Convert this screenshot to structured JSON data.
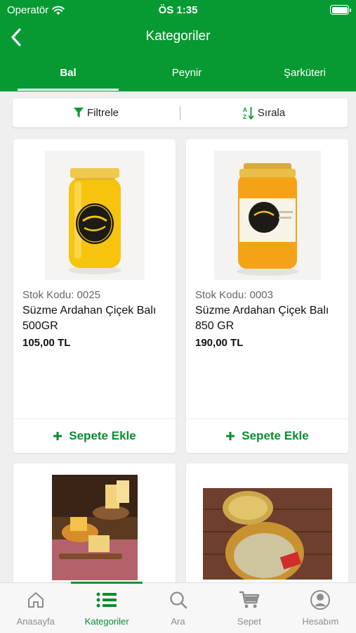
{
  "status": {
    "carrier": "Operatör",
    "time": "ÖS 1:35"
  },
  "header": {
    "title": "Kategoriler"
  },
  "tabs": [
    {
      "label": "Bal",
      "active": true
    },
    {
      "label": "Peynir",
      "active": false
    },
    {
      "label": "Şarküteri",
      "active": false
    }
  ],
  "toolbar": {
    "filter_label": "Filtrele",
    "sort_label": "Sırala"
  },
  "products": [
    {
      "sku": "Stok Kodu: 0025",
      "name": "Süzme Ardahan Çiçek Balı 500GR",
      "price": "105,00 TL",
      "cart_label": "Sepete Ekle"
    },
    {
      "sku": "Stok Kodu: 0003",
      "name": "Süzme Ardahan Çiçek Balı 850 GR",
      "price": "190,00 TL",
      "cart_label": "Sepete Ekle"
    }
  ],
  "bottom_nav": [
    {
      "label": "Anasayfa",
      "icon": "home-icon",
      "active": false
    },
    {
      "label": "Kategoriler",
      "icon": "list-icon",
      "active": true
    },
    {
      "label": "Ara",
      "icon": "search-icon",
      "active": false
    },
    {
      "label": "Sepet",
      "icon": "cart-icon",
      "active": false
    },
    {
      "label": "Hesabım",
      "icon": "account-icon",
      "active": false
    }
  ],
  "colors": {
    "brand_green": "#079a32",
    "accent_green": "#0a8d30",
    "inactive_gray": "#8d8d8d"
  }
}
